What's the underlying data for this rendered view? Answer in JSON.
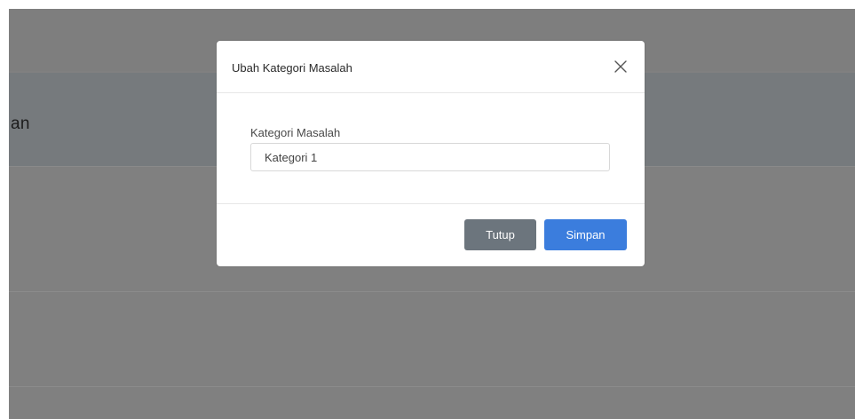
{
  "background": {
    "header_partial_text": "an",
    "overlay_color": "#808080"
  },
  "modal": {
    "title": "Ubah Kategori Masalah",
    "close_icon": "close-icon",
    "field": {
      "label": "Kategori Masalah",
      "value": "Kategori 1"
    },
    "buttons": {
      "close_label": "Tutup",
      "save_label": "Simpan"
    },
    "colors": {
      "close_button": "#6c757d",
      "save_button": "#3b7ddd"
    }
  }
}
